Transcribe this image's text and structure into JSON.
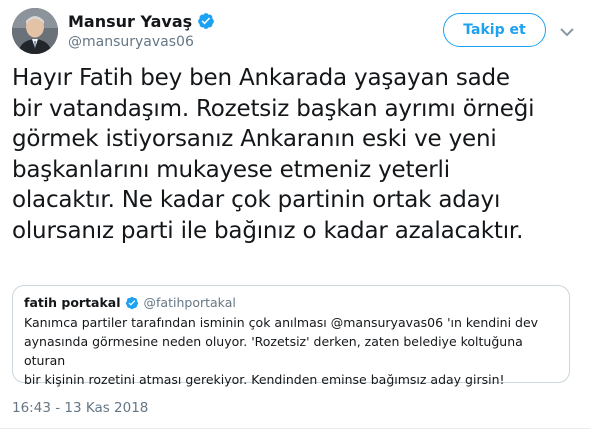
{
  "author": {
    "display_name": "Mansur Yavaş",
    "handle": "@mansuryavas06"
  },
  "follow_button_label": "Takip et",
  "tweet": {
    "lines": [
      "Hayır Fatih bey ben Ankarada yaşayan sade",
      "bir vatandaşım. Rozetsiz başkan ayrımı örneği",
      "görmek istiyorsanız Ankaranın eski ve yeni",
      "başkanlarını mukayese etmeniz yeterli",
      "olacaktır. Ne kadar çok partinin ortak adayı",
      "olursanız parti ile bağınız o kadar azalacaktır."
    ],
    "timestamp": "16:43 - 13 Kas 2018"
  },
  "quoted_tweet": {
    "display_name": "fatih portakal",
    "handle": "@fatihportakal",
    "lines": [
      "Kanımca partiler tarafından isminin çok anılması @mansuryavas06 'ın kendini dev",
      "aynasında görmesine neden oluyor. 'Rozetsiz' derken, zaten belediye koltuğuna oturan",
      "bir kişinin rozetini atması gerekiyor. Kendinden eminse bağımsız aday girsin!"
    ]
  },
  "icons": {
    "verified": "verified-badge-icon",
    "more": "chevron-down-icon"
  },
  "colors": {
    "accent": "#1da1f2",
    "text": "#14171a",
    "muted": "#657786",
    "border": "#ccd6dd"
  }
}
